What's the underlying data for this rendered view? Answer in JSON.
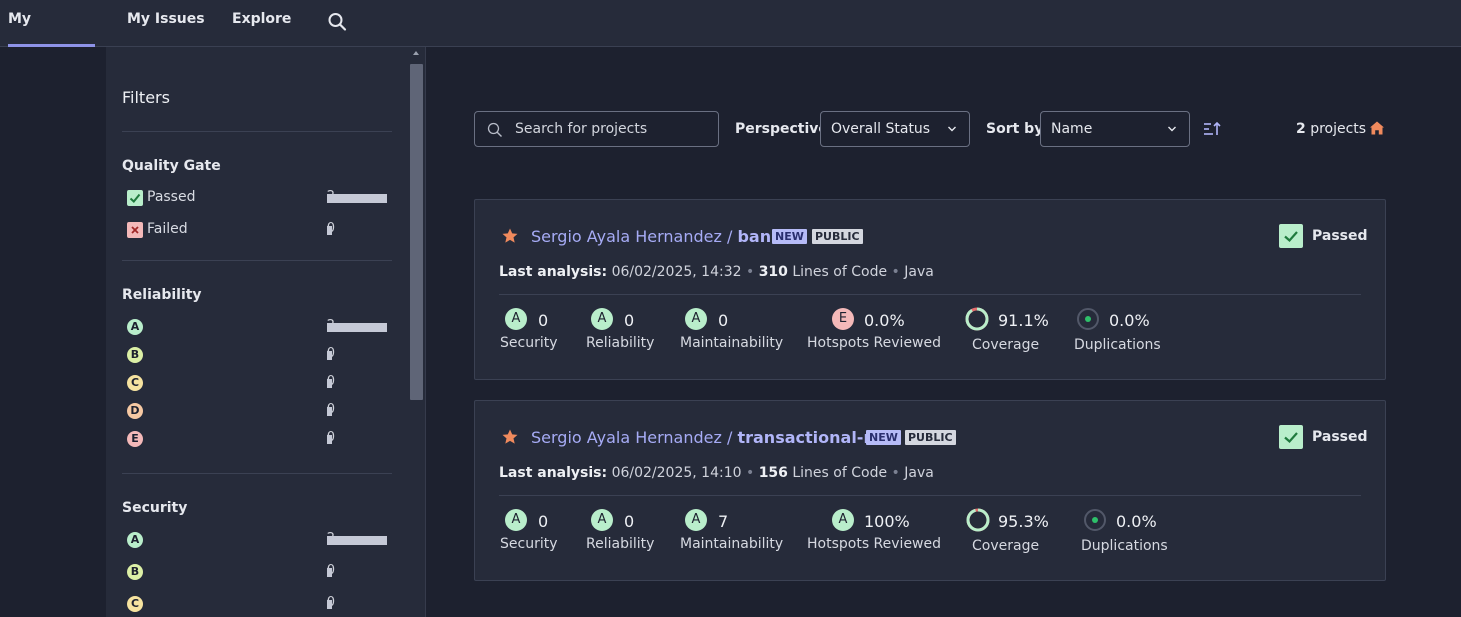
{
  "nav": {
    "items": [
      "My Projects",
      "My Issues",
      "Explore"
    ],
    "active": "My Projects"
  },
  "sidebar": {
    "title": "Filters",
    "quality_gate": {
      "title": "Quality Gate",
      "items": [
        {
          "label": "Passed",
          "count": "2",
          "share": 1.0
        },
        {
          "label": "Failed",
          "count": "0",
          "share": 0.0
        }
      ]
    },
    "reliability": {
      "title": "Reliability",
      "items": [
        {
          "label": "A",
          "count": "2",
          "share": 1.0
        },
        {
          "label": "B",
          "count": "0",
          "share": 0.0
        },
        {
          "label": "C",
          "count": "0",
          "share": 0.0
        },
        {
          "label": "D",
          "count": "0",
          "share": 0.0
        },
        {
          "label": "E",
          "count": "0",
          "share": 0.0
        }
      ]
    },
    "security": {
      "title": "Security",
      "items": [
        {
          "label": "A",
          "count": "2",
          "share": 1.0
        },
        {
          "label": "B",
          "count": "0",
          "share": 0.0
        },
        {
          "label": "C",
          "count": "0",
          "share": 0.0
        }
      ]
    }
  },
  "toolbar": {
    "search_placeholder": "Search for projects",
    "perspective_label": "Perspective",
    "perspective_value": "Overall Status",
    "sort_label": "Sort by",
    "sort_value": "Name",
    "count_number": "2",
    "count_suffix": " projects"
  },
  "projects": [
    {
      "org": "Sergio Ayala Hernandez",
      "sep": " / ",
      "key": "bank",
      "badge_new": "NEW",
      "badge_public": "PUBLIC",
      "qg": "Passed",
      "analysis_label": "Last analysis:",
      "analysis_date": " 06/02/2025, 14:32 ",
      "loc": "310",
      "loc_label": " Lines of Code ",
      "language": " Java",
      "security": {
        "rating": "A",
        "value": "0",
        "label": "Security"
      },
      "reliability": {
        "rating": "A",
        "value": "0",
        "label": "Reliability"
      },
      "maintainability": {
        "rating": "A",
        "value": "0",
        "label": "Maintainability"
      },
      "hotspots": {
        "rating": "E",
        "value": "0.0%",
        "label": "Hotspots Reviewed"
      },
      "coverage": {
        "value": "91.1%",
        "label": "Coverage",
        "fraction": 0.911
      },
      "duplications": {
        "value": "0.0%",
        "label": "Duplications"
      }
    },
    {
      "org": "Sergio Ayala Hernandez",
      "sep": " / ",
      "key": "transactional-ms",
      "badge_new": "NEW",
      "badge_public": "PUBLIC",
      "qg": "Passed",
      "analysis_label": "Last analysis:",
      "analysis_date": " 06/02/2025, 14:10 ",
      "loc": "156",
      "loc_label": " Lines of Code ",
      "language": " Java",
      "security": {
        "rating": "A",
        "value": "0",
        "label": "Security"
      },
      "reliability": {
        "rating": "A",
        "value": "0",
        "label": "Reliability"
      },
      "maintainability": {
        "rating": "A",
        "value": "7",
        "label": "Maintainability"
      },
      "hotspots": {
        "rating": "A",
        "value": "100%",
        "label": "Hotspots Reviewed"
      },
      "coverage": {
        "value": "95.3%",
        "label": "Coverage",
        "fraction": 0.953
      },
      "duplications": {
        "value": "0.0%",
        "label": "Duplications"
      }
    }
  ],
  "colors": {
    "rating_A": "#b9eecb",
    "rating_B": "#dcf0a6",
    "rating_C": "#f6e3a0",
    "rating_D": "#f6c9a3",
    "rating_E": "#f4b9b9",
    "accent": "#8e93e8",
    "star": "#f08a5d"
  }
}
